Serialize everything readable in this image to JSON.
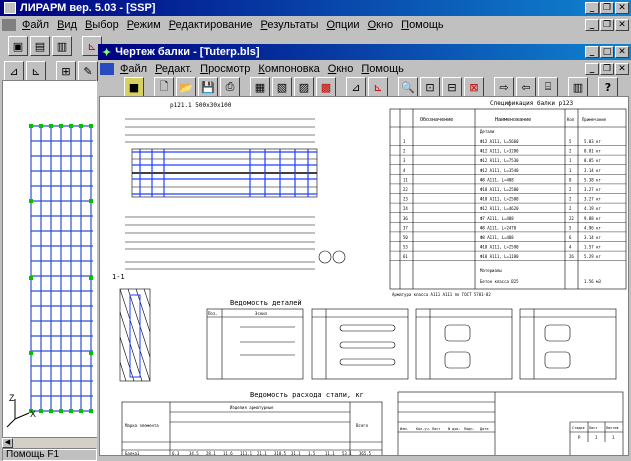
{
  "app": {
    "title": "ЛИРАРМ  вер. 5.03 - [SSP]",
    "menu": [
      "Файл",
      "Вид",
      "Выбор",
      "Режим",
      "Редактирование",
      "Результаты",
      "Опции",
      "Окно",
      "Помощь"
    ]
  },
  "child": {
    "title": "Чертеж балки - [Tuterp.bls]",
    "menu": [
      "Файл",
      "Редакт.",
      "Просмотр",
      "Компоновка",
      "Окно",
      "Помощь"
    ]
  },
  "status": {
    "text": "Помощь F1"
  },
  "axis": {
    "z": "Z",
    "x": "X"
  },
  "drawing": {
    "beam_title": "p121.1 500x30x100",
    "section_label": "1-1",
    "spec_title": "Спецификация балки p123",
    "spec_headers": [
      "Обозначение",
      "Наименование",
      "Кол",
      "Примечание"
    ],
    "spec_group": "Детали",
    "spec_rows": [
      [
        "1",
        "Ф12 A111, L=5660",
        "5",
        "5.03 кг"
      ],
      [
        "2",
        "Ф12 A111, L=3280",
        "2",
        "8.81 кг"
      ],
      [
        "3",
        "Ф12 A111, L=7530",
        "1",
        "8.85 кг"
      ],
      [
        "4",
        "Ф12 A111, L=3540",
        "1",
        "3.14 кг"
      ],
      [
        "11",
        "Ф8 A111, L=488",
        "8",
        "5.38 кг"
      ],
      [
        "22",
        "Ф18 A111, L=2580",
        "2",
        "3.27 кг"
      ],
      [
        "23",
        "Ф18 A111, L=2580",
        "2",
        "3.27 кг"
      ],
      [
        "24",
        "Ф12 A111, L=4620",
        "2",
        "4.19 кг"
      ],
      [
        "36",
        "Ф7 A111, L=488",
        "22",
        "9.88 кг"
      ],
      [
        "37",
        "Ф8 A111, L=2470",
        "5",
        "4.96 кг"
      ],
      [
        "50",
        "Ф8 A111, L=488",
        "6",
        "3.14 кг"
      ],
      [
        "53",
        "Ф18 A111, L=2590",
        "4",
        "1.57 кг"
      ],
      [
        "61",
        "Ф18 A111, L=1180",
        "26",
        "5.29 кг"
      ]
    ],
    "spec_material_label": "Материалы",
    "spec_concrete": "Бетон класса B25",
    "spec_concrete_amount": "1.56 м3",
    "spec_note": "Арматура класса A111 A111 по ГОСТ 5781-82",
    "details_title": "Ведомость деталей",
    "details_headers": [
      "Поз.",
      "Эскиз"
    ],
    "steel_title": "Ведомость расхода стали, кг",
    "steel_header_1": "Марка элемента",
    "steel_header_2": "Изделия арматурные",
    "steel_header_3": "Всего",
    "steel_row_label": "Балка1",
    "steel_values": [
      "6.3",
      "34.5",
      "28.1",
      "11.6",
      "111.1",
      "21.1",
      "318.5",
      "31.1",
      "1.5",
      "11.1",
      "53.1",
      "365.5"
    ],
    "stamp_headers": [
      "Изм.",
      "Кол.уч.",
      "Лист",
      "N док.",
      "Подп.",
      "Дата"
    ],
    "stamp_sheet": [
      "Стадия",
      "Лист",
      "Листов"
    ],
    "stamp_sheet_values": [
      "Р",
      "1",
      "1"
    ]
  }
}
